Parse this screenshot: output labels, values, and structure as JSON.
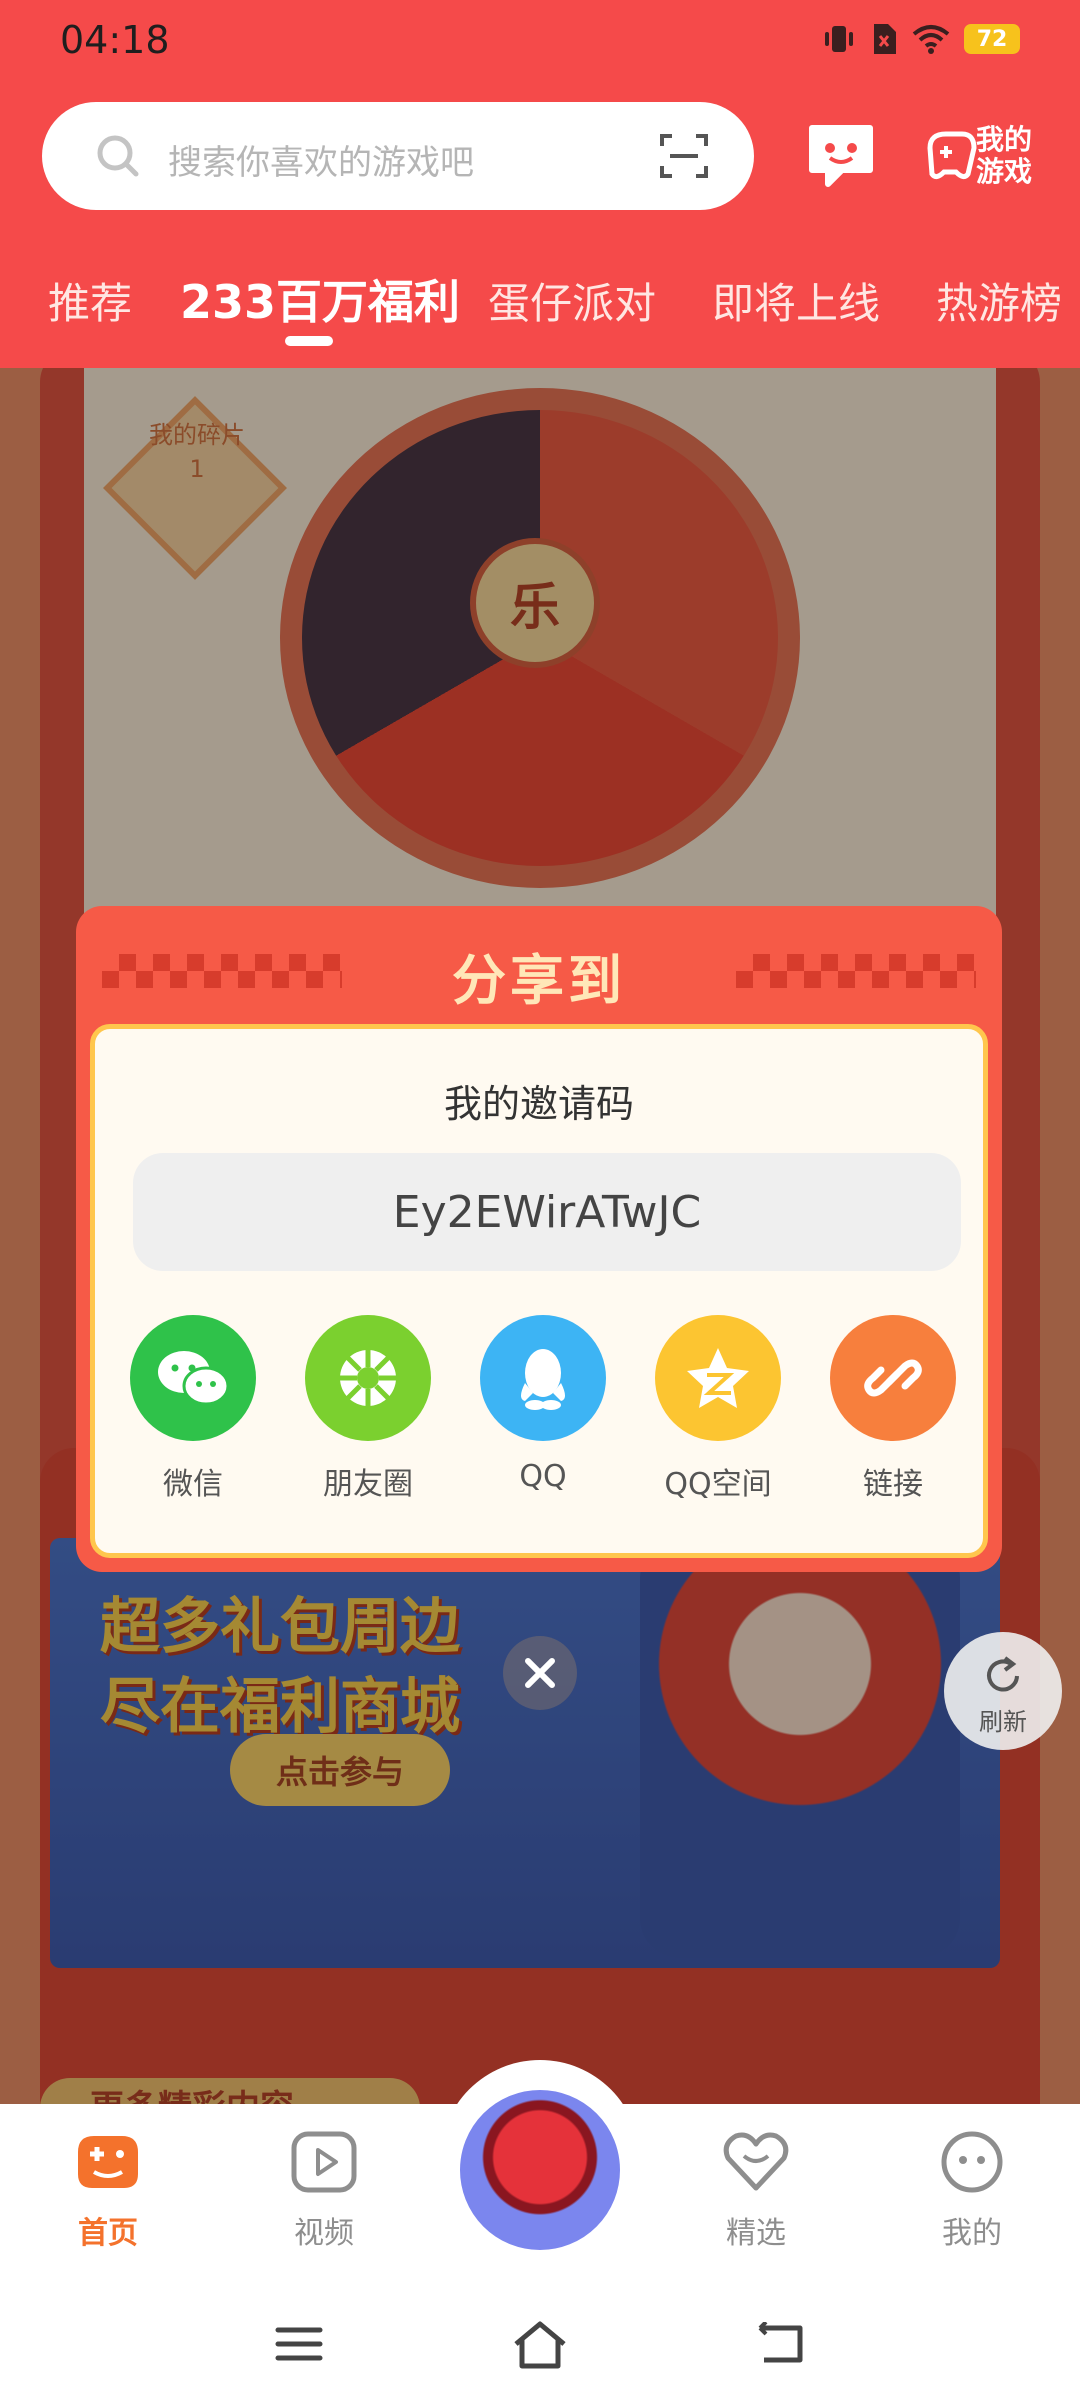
{
  "status_bar": {
    "time": "04:18",
    "battery": "72"
  },
  "header": {
    "search_placeholder": "搜索你喜欢的游戏吧",
    "my_games_label": "我的游戏",
    "tabs": [
      {
        "label": "推荐"
      },
      {
        "label": "233百万福利"
      },
      {
        "label": "蛋仔派对"
      },
      {
        "label": "即将上线"
      },
      {
        "label": "热游榜"
      }
    ],
    "active_tab": "233百万福利"
  },
  "background": {
    "shard_label": "我的碎片",
    "shard_count": "1",
    "wheel_center": "乐",
    "banner_line1": "超多礼包周边",
    "banner_line2": "尽在福利商城",
    "banner_button": "点击参与",
    "section_title": "更多精彩内容"
  },
  "share_dialog": {
    "title": "分享到",
    "invite_label": "我的邀请码",
    "invite_code": "Ey2EWirATwJC",
    "targets": [
      {
        "label": "微信",
        "icon": "wechat-icon",
        "color": "#2fc24a"
      },
      {
        "label": "朋友圈",
        "icon": "moments-icon",
        "color": "#7bd02f"
      },
      {
        "label": "QQ",
        "icon": "qq-icon",
        "color": "#3db4f4"
      },
      {
        "label": "QQ空间",
        "icon": "qzone-icon",
        "color": "#fcc531"
      },
      {
        "label": "链接",
        "icon": "link-icon",
        "color": "#f77f3d"
      }
    ]
  },
  "refresh_label": "刷新",
  "bottom_nav": {
    "items": [
      {
        "label": "首页",
        "active": true
      },
      {
        "label": "视频"
      },
      {
        "label": "精选"
      },
      {
        "label": "我的"
      }
    ]
  },
  "colors": {
    "brand_red": "#f54a4a",
    "active_orange": "#f4722c",
    "dialog_red": "#f65a47"
  }
}
